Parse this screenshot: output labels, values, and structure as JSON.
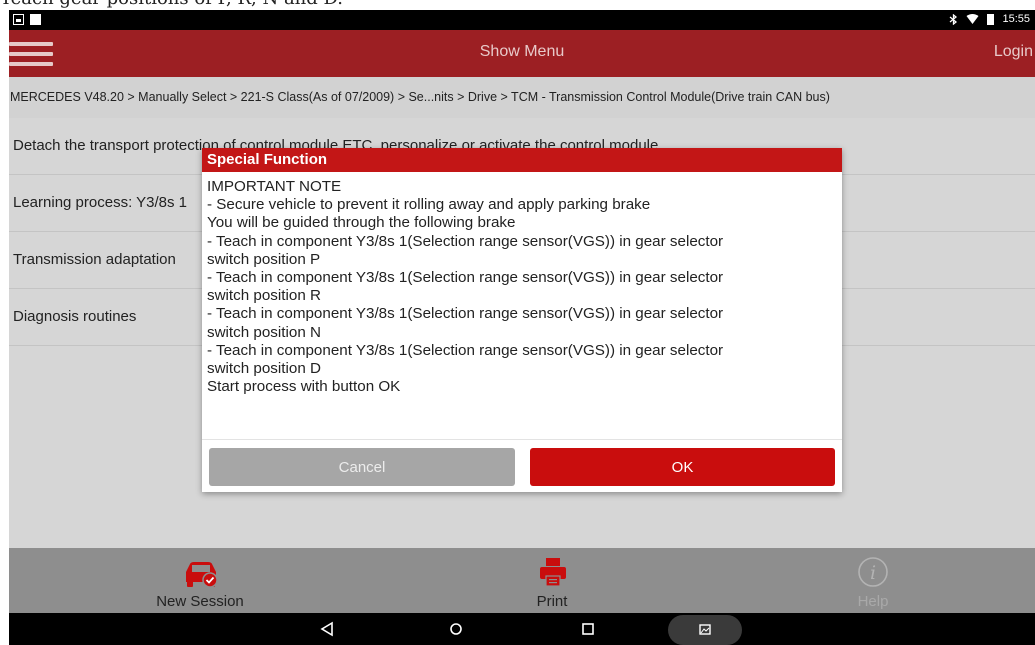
{
  "page_top_text": "Teach gear positions of P, R, N and D.",
  "status_bar": {
    "time": "15:55",
    "icons": [
      "image-icon",
      "notification-icon",
      "bluetooth-icon",
      "wifi-icon",
      "battery-icon"
    ]
  },
  "app_bar": {
    "title": "Show Menu",
    "login": "Login",
    "color": "#9c1f23"
  },
  "breadcrumb": "MERCEDES V48.20 > Manually Select > 221-S Class(As of 07/2009) > Se...nits > Drive > TCM - Transmission Control Module(Drive train CAN bus)",
  "list_items": [
    "Detach the transport protection of control module ETC, personalize or activate the control module",
    "Learning process: Y3/8s 1",
    "Transmission adaptation",
    "Diagnosis routines"
  ],
  "dialog": {
    "title": "Special Function",
    "lines": [
      "IMPORTANT NOTE",
      " - Secure vehicle to prevent it rolling away and apply parking brake",
      "You will be guided through the following brake",
      " - Teach in component Y3/8s 1(Selection range sensor(VGS)) in gear selector",
      "switch position P",
      " - Teach in component Y3/8s 1(Selection range sensor(VGS)) in gear selector",
      "switch position R",
      " - Teach in component Y3/8s 1(Selection range sensor(VGS)) in gear selector",
      "switch position N",
      " - Teach in component Y3/8s 1(Selection range sensor(VGS)) in gear selector",
      "switch position D",
      "Start process with button OK"
    ],
    "cancel_label": "Cancel",
    "ok_label": "OK",
    "title_color": "#c31616",
    "ok_color": "#c90d0d"
  },
  "bottom_bar": {
    "new_session": "New Session",
    "print": "Print",
    "help": "Help"
  },
  "nav_bar": {
    "icons": [
      "back-icon",
      "home-icon",
      "recents-icon",
      "screenshot-icon"
    ]
  }
}
